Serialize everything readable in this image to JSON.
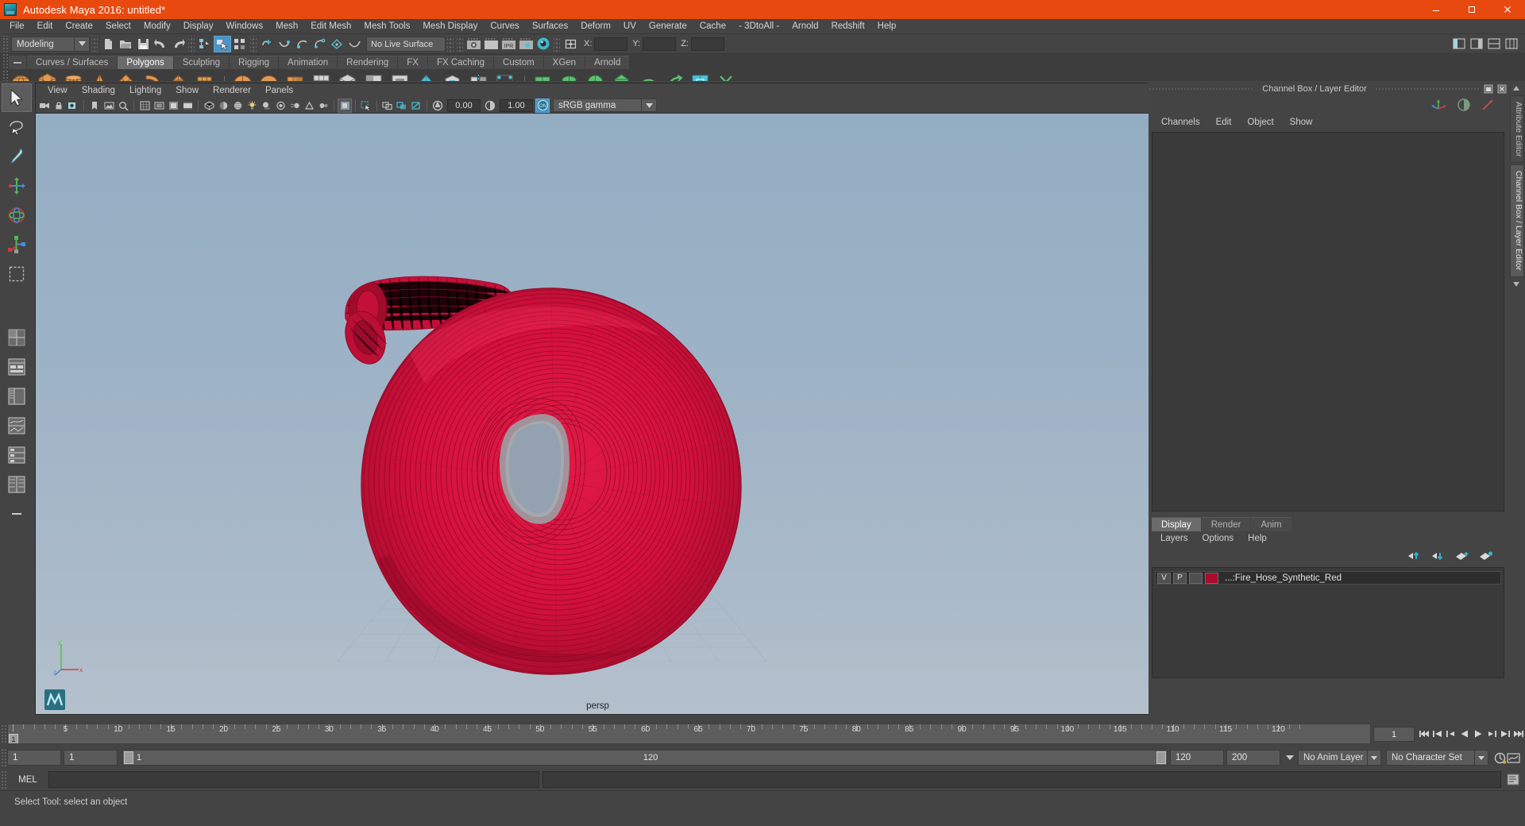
{
  "window": {
    "title": "Autodesk Maya 2016: untitled*",
    "logo_icon": "maya-logo-icon",
    "minimize_icon": "minimize-icon",
    "maximize_icon": "maximize-icon",
    "close_icon": "close-icon",
    "titlebar_color": "#e8490f"
  },
  "menubar": {
    "items": [
      "File",
      "Edit",
      "Create",
      "Select",
      "Modify",
      "Display",
      "Windows",
      "Mesh",
      "Edit Mesh",
      "Mesh Tools",
      "Mesh Display",
      "Curves",
      "Surfaces",
      "Deform",
      "UV",
      "Generate",
      "Cache",
      "- 3DtoAll -",
      "Arnold",
      "Redshift",
      "Help"
    ]
  },
  "statusline": {
    "mode": "Modeling",
    "mode_arrow_icon": "chevron-down-icon",
    "live_surface": "No Live Surface",
    "axis_labels": [
      "X:",
      "Y:",
      "Z:"
    ],
    "axis_values": [
      "",
      "",
      ""
    ],
    "icons": [
      "new-scene-icon",
      "open-scene-icon",
      "save-scene-icon",
      "undo-icon",
      "redo-icon",
      "select-hierarchy-icon",
      "select-object-icon",
      "select-component-icon",
      "snap-grid-icon",
      "snap-curve-icon",
      "snap-point-icon",
      "snap-projected-center-icon",
      "snap-view-plane-icon",
      "make-live-icon",
      "render-view-icon",
      "render-sequence-icon",
      "ipr-render-icon",
      "render-settings-icon",
      "hypershade-icon",
      "input-output-connections-icon"
    ],
    "right_icons": [
      "show-hide-modeling-toolkit-icon",
      "show-hide-attribute-editor-icon",
      "show-hide-tool-settings-icon",
      "show-hide-channel-box-icon"
    ]
  },
  "shelf": {
    "tabs": [
      "Curves / Surfaces",
      "Polygons",
      "Sculpting",
      "Rigging",
      "Animation",
      "Rendering",
      "FX",
      "FX Caching",
      "Custom",
      "XGen",
      "Arnold"
    ],
    "active_tab": "Polygons",
    "tab_menu_icon": "shelf-menu-icon",
    "icons": [
      "poly-sphere-icon",
      "poly-cube-icon",
      "poly-cylinder-icon",
      "poly-cone-icon",
      "poly-torus-icon",
      "poly-plane-icon",
      "poly-disc-icon",
      "poly-platonic-icon",
      "poly-pyramid-icon",
      "poly-prism-icon",
      "poly-pipe-icon",
      "poly-helix-icon",
      "poly-gear-icon",
      "poly-soccer-ball-icon",
      "poly-super-ellipse-icon",
      "poly-sphere-type-icon",
      "poly-ultra-shape-icon",
      "poly-combine-icon",
      "poly-separate-icon",
      "poly-booleans-icon",
      "poly-smooth-icon",
      "poly-extrude-icon",
      "poly-bevel-icon",
      "poly-bridge-icon",
      "poly-merge-icon",
      "poly-append-icon",
      "poly-mirror-icon",
      "poly-quad-draw-icon"
    ]
  },
  "toolbox": {
    "items": [
      "select-tool",
      "lasso-select-tool",
      "paint-select-tool",
      "move-tool",
      "rotate-tool",
      "scale-tool",
      "last-tool-used",
      "four-view-layout",
      "single-perspective-layout",
      "outliner-persp-layout",
      "persp-graph-layout",
      "hypershade-persp-layout",
      "persp-hierarchy-layout",
      "extra-layout"
    ],
    "selected": "select-tool"
  },
  "viewport": {
    "menus": [
      "View",
      "Shading",
      "Lighting",
      "Show",
      "Renderer",
      "Panels"
    ],
    "camera_label": "persp",
    "exposure_value": "0.00",
    "gamma_value": "1.00",
    "color_management": "sRGB gamma",
    "color_management_arrow_icon": "chevron-down-icon",
    "gamma_toggle_icon": "color-management-on-icon",
    "toolbar_icons": [
      "select-camera-icon",
      "lock-camera-icon",
      "camera-attributes-icon",
      "bookmark-icon",
      "image-plane-icon",
      "two-d-pan-zoom-icon",
      "grid-toggle-icon",
      "film-gate-icon",
      "resolution-gate-icon",
      "gate-mask-icon",
      "film-origin-icon",
      "wireframe-icon",
      "smooth-shade-all-icon",
      "smooth-shade-textured-icon",
      "use-all-lights-icon",
      "shadows-icon",
      "screen-space-ao-icon",
      "motion-blur-icon",
      "multisample-aa-icon",
      "depth-of-field-icon",
      "isolate-select-icon",
      "xray-icon",
      "xray-joints-icon",
      "exposure-icon",
      "gamma-icon"
    ],
    "background_top_color": "#95aec4",
    "background_bottom_color": "#b2bfcb",
    "model_color": "#d4103c",
    "model_name": "fire-hose-coil-wireframe"
  },
  "channelbox": {
    "panel_title": "Channel Box / Layer Editor",
    "undock_icon": "undock-icon",
    "close_icon": "close-panel-icon",
    "menus": [
      "Channels",
      "Edit",
      "Object",
      "Show"
    ],
    "toolbar_icons": [
      "channel-box-icon",
      "attribute-blend-icon",
      "anim-layer-icon"
    ]
  },
  "layer_editor": {
    "tabs": [
      "Display",
      "Render",
      "Anim"
    ],
    "active_tab": "Display",
    "menus": [
      "Layers",
      "Options",
      "Help"
    ],
    "toolbar_icons": [
      "move-layer-up-icon",
      "move-layer-down-icon",
      "new-layer-icon",
      "new-layer-from-selected-icon"
    ],
    "layers": [
      {
        "visibility": "V",
        "playback": "P",
        "shading": "",
        "color": "#aa0c2c",
        "name": "...:Fire_Hose_Synthetic_Red"
      }
    ]
  },
  "side_tabs": [
    "Attribute Editor",
    "Channel Box / Layer Editor"
  ],
  "time_slider": {
    "current_frame": "1",
    "start_display": "1",
    "tick_labels": [
      "5",
      "10",
      "15",
      "20",
      "25",
      "30",
      "35",
      "40",
      "45",
      "50",
      "55",
      "60",
      "65",
      "70",
      "75",
      "80",
      "85",
      "90",
      "95",
      "100",
      "105",
      "110",
      "115",
      "120"
    ],
    "frame_field": "1",
    "playback_icons": [
      "go-to-start-icon",
      "step-back-key-icon",
      "step-back-frame-icon",
      "play-backwards-icon",
      "play-forwards-icon",
      "step-forward-frame-icon",
      "step-forward-key-icon",
      "go-to-end-icon"
    ]
  },
  "range_slider": {
    "anim_start": "1",
    "range_start": "1",
    "range_bar_start_label": "1",
    "range_bar_end_label": "120",
    "range_end": "120",
    "anim_end": "200",
    "anim_layer": "No Anim Layer",
    "anim_layer_arrow_icon": "chevron-down-icon",
    "character_set": "No Character Set",
    "character_set_arrow_icon": "chevron-down-icon",
    "auto_key_icon": "auto-keyframe-icon",
    "anim_prefs_icon": "animation-preferences-icon"
  },
  "command_line": {
    "label": "MEL",
    "input_value": "",
    "output_value": "",
    "script_editor_icon": "script-editor-icon"
  },
  "help_line": {
    "text": "Select Tool: select an object"
  }
}
